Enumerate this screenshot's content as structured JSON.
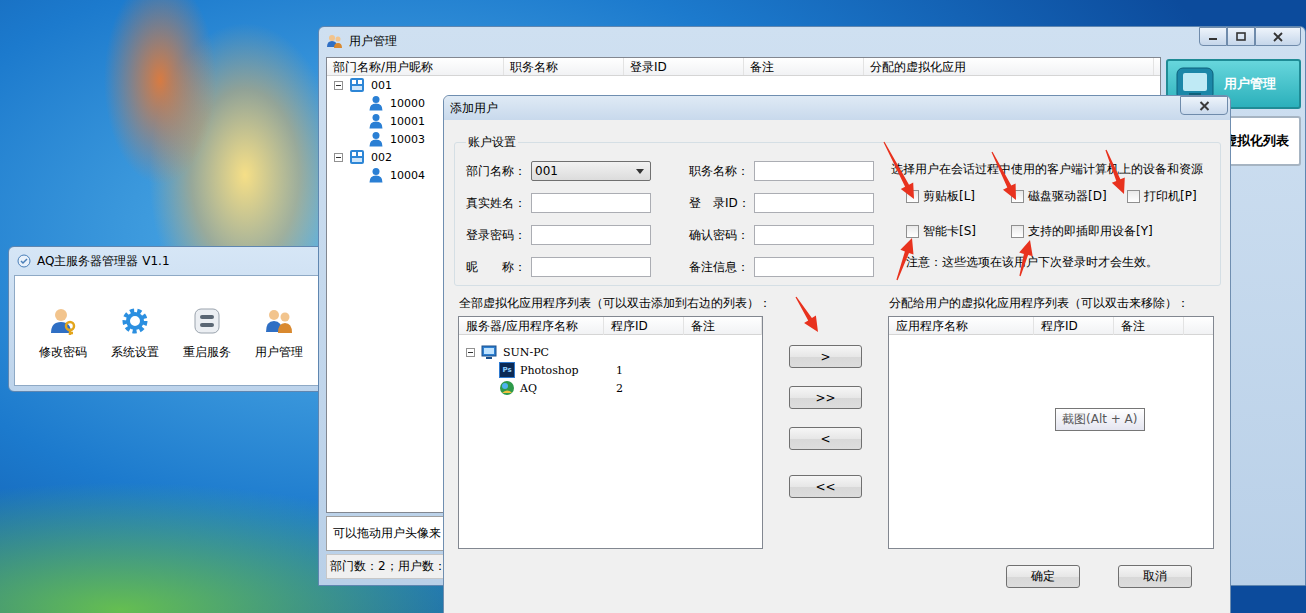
{
  "launcher": {
    "title": "AQ主服务器管理器 V1.1",
    "tools": [
      {
        "label": "修改密码",
        "kind": "password"
      },
      {
        "label": "系统设置",
        "kind": "settings"
      },
      {
        "label": "重启服务",
        "kind": "restart"
      },
      {
        "label": "用户管理",
        "kind": "users"
      }
    ]
  },
  "user_window": {
    "title": "用户管理",
    "columns": [
      "部门名称/用户昵称",
      "职务名称",
      "登录ID",
      "备注",
      "分配的虚拟化应用"
    ],
    "departments": [
      {
        "name": "001",
        "expanded": true,
        "users": [
          "10000",
          "10001",
          "10003"
        ]
      },
      {
        "name": "002",
        "expanded": true,
        "users": [
          "10004"
        ]
      }
    ],
    "hint": "可以拖动用户头像来",
    "status_bar": "部门数：2；用户数：",
    "nav": [
      {
        "label": "用户管理",
        "selected": true
      },
      {
        "label": "虚拟化列表",
        "selected": false
      }
    ]
  },
  "dialog": {
    "title": "添加用户",
    "account_group": "账户设置",
    "fields": [
      {
        "label": "部门名称：",
        "kind": "select",
        "value": "001"
      },
      {
        "label": "职务名称：",
        "kind": "text",
        "value": ""
      },
      {
        "label": "真实姓名：",
        "kind": "text",
        "value": ""
      },
      {
        "label": "登　录ID：",
        "kind": "text",
        "value": ""
      },
      {
        "label": "登录密码：",
        "kind": "password",
        "value": ""
      },
      {
        "label": "确认密码：",
        "kind": "password",
        "value": ""
      },
      {
        "label": "昵　　称：",
        "kind": "text",
        "value": ""
      },
      {
        "label": "备注信息：",
        "kind": "text",
        "value": ""
      }
    ],
    "devices": {
      "heading": "选择用户在会话过程中使用的客户端计算机上的设备和资源",
      "options": [
        {
          "label": "剪贴板[L]",
          "checked": false
        },
        {
          "label": "磁盘驱动器[D]",
          "checked": false
        },
        {
          "label": "打印机[P]",
          "checked": false
        },
        {
          "label": "智能卡[S]",
          "checked": false
        },
        {
          "label": "支持的即插即用设备[Y]",
          "checked": false
        }
      ],
      "note": "注意：这些选项在该用户下次登录时才会生效。"
    },
    "available": {
      "label": "全部虚拟化应用程序列表（可以双击添加到右边的列表）：",
      "columns": [
        "服务器/应用程序名称",
        "程序ID",
        "备注"
      ],
      "servers": [
        {
          "name": "SUN-PC",
          "expanded": true,
          "apps": [
            {
              "name": "Photoshop",
              "id": "1",
              "kind": "photoshop",
              "badge": "Ps"
            },
            {
              "name": "AQ",
              "id": "2",
              "kind": "aq"
            }
          ]
        }
      ]
    },
    "move_buttons": [
      ">",
      ">>",
      "<",
      "<<"
    ],
    "assigned": {
      "label": "分配给用户的虚拟化应用程序列表（可以双击来移除）：",
      "columns": [
        "应用程序名称",
        "程序ID",
        "备注"
      ],
      "apps": []
    },
    "tooltip": "截图(Alt + A)",
    "buttons": [
      "确定",
      "取消"
    ]
  }
}
